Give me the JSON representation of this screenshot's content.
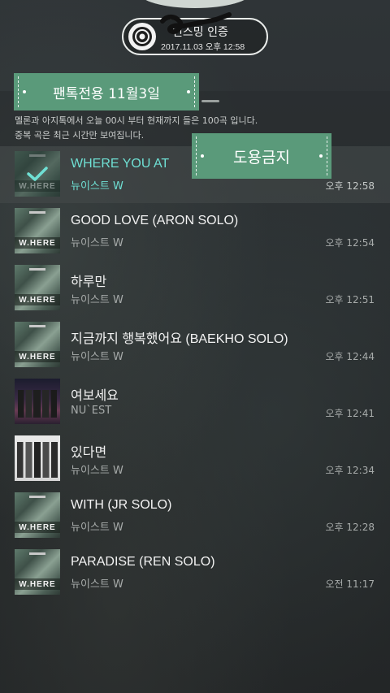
{
  "status": {
    "title": "인스밍 인증",
    "date": "2017.11.03 오후 12:58"
  },
  "labels": {
    "fan_only": "팬톡전용 11월3일",
    "no_use": "도용금지"
  },
  "info": {
    "line1": "멜론과 아지톡에서 오늘 00시 부터 현재까지 들은 100곡 입니다.",
    "line2": "중복 곡은 최근 시간만 보여집니다."
  },
  "tracks": [
    {
      "title": "WHERE YOU AT",
      "artist": "뉴이스트 W",
      "time": "오후 12:58",
      "art": "where",
      "active": true
    },
    {
      "title": "GOOD LOVE (ARON SOLO)",
      "artist": "뉴이스트 W",
      "time": "오후 12:54",
      "art": "where"
    },
    {
      "title": "하루만",
      "artist": "뉴이스트 W",
      "time": "오후 12:51",
      "art": "where"
    },
    {
      "title": "지금까지 행복했어요 (BAEKHO SOLO)",
      "artist": "뉴이스트 W",
      "time": "오후 12:44",
      "art": "where"
    },
    {
      "title": "여보세요",
      "artist": "NU`EST",
      "time": "오후 12:41",
      "art": "nuest-dark"
    },
    {
      "title": "있다면",
      "artist": "뉴이스트 W",
      "time": "오후 12:34",
      "art": "nuest-light"
    },
    {
      "title": "WITH (JR SOLO)",
      "artist": "뉴이스트 W",
      "time": "오후 12:28",
      "art": "where"
    },
    {
      "title": "PARADISE (REN SOLO)",
      "artist": "뉴이스트 W",
      "time": "오전 11:17",
      "art": "where"
    }
  ],
  "album_text": "W.HERE",
  "colors": {
    "accent": "#6fe0d4",
    "label_green": "#5a9a7a"
  }
}
